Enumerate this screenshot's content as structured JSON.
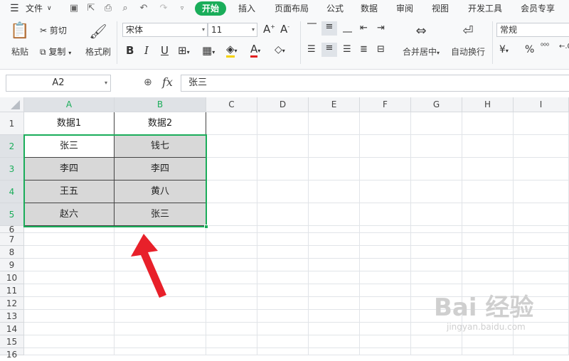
{
  "menubar": {
    "file_label": "文件",
    "tabs": [
      "开始",
      "插入",
      "页面布局",
      "公式",
      "数据",
      "审阅",
      "视图",
      "开发工具",
      "会员专享"
    ],
    "active_tab": "开始"
  },
  "ribbon": {
    "paste_label": "粘贴",
    "cut_label": "剪切",
    "copy_label": "复制",
    "format_painter_label": "格式刷",
    "font_name": "宋体",
    "font_size": "11",
    "merge_label": "合并居中",
    "wrap_label": "自动换行",
    "number_format": "常规"
  },
  "formula_bar": {
    "name_box": "A2",
    "fx_label": "fx",
    "formula": "张三"
  },
  "sheet": {
    "columns": [
      "A",
      "B",
      "C",
      "D",
      "E",
      "F",
      "G",
      "H",
      "I"
    ],
    "rows": [
      "1",
      "2",
      "3",
      "4",
      "5",
      "6",
      "7",
      "8",
      "9",
      "10",
      "11",
      "12",
      "13",
      "14",
      "15",
      "16",
      "17"
    ],
    "header_row": [
      "数据1",
      "数据2"
    ],
    "data": [
      [
        "张三",
        "钱七"
      ],
      [
        "李四",
        "李四"
      ],
      [
        "王五",
        "黄八"
      ],
      [
        "赵六",
        "张三"
      ]
    ]
  },
  "colors": {
    "accent": "#1aad5a",
    "duplicate_fill": "#d8d8d8",
    "arrow": "#e8202a"
  },
  "watermark": {
    "text": "Bai 经验",
    "url_text": "jingyan.baidu.com"
  }
}
